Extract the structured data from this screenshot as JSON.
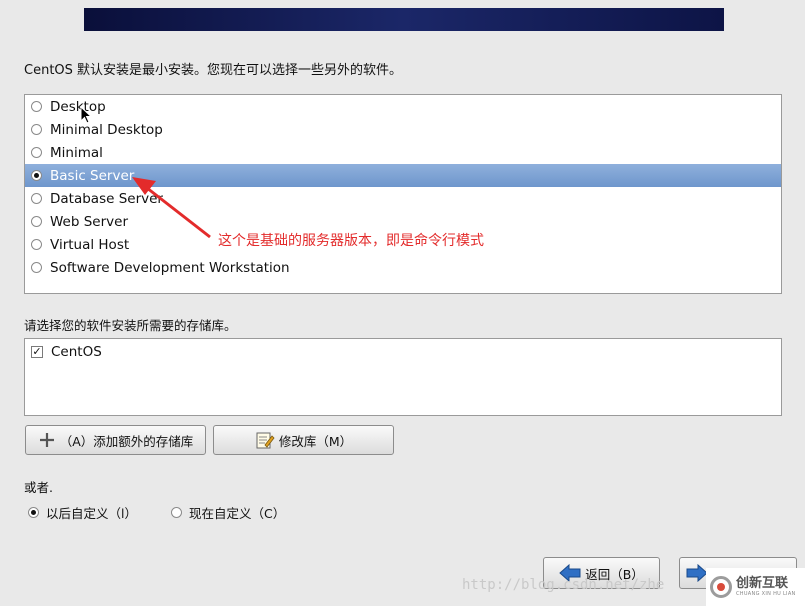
{
  "intro_text": "CentOS 默认安装是最小安装。您现在可以选择一些另外的软件。",
  "environments": [
    {
      "label": "Desktop",
      "selected": false
    },
    {
      "label": "Minimal Desktop",
      "selected": false
    },
    {
      "label": "Minimal",
      "selected": false
    },
    {
      "label": "Basic Server",
      "selected": true
    },
    {
      "label": "Database Server",
      "selected": false
    },
    {
      "label": "Web Server",
      "selected": false
    },
    {
      "label": "Virtual Host",
      "selected": false
    },
    {
      "label": "Software Development Workstation",
      "selected": false
    }
  ],
  "repo_section_label": "请选择您的软件安装所需要的存储库。",
  "repos": [
    {
      "label": "CentOS",
      "checked": true
    }
  ],
  "buttons": {
    "add_repo": "（A）添加额外的存储库",
    "modify_repo": "修改库（M）",
    "back": "返回（B）"
  },
  "customize": {
    "label": "或者.",
    "later": "以后自定义（l）",
    "now": "现在自定义（C）",
    "selected": "later"
  },
  "annotation": "这个是基础的服务器版本，即是命令行模式",
  "watermark": "http://blog.csdn.net/zhe",
  "logo": {
    "cn": "创新互联",
    "en": "CHUANG XIN HU LIAN"
  },
  "colors": {
    "selection": "#7aa0d2",
    "annotation": "#e32b2b"
  },
  "icons": {
    "add": "plus-icon",
    "modify": "edit-notepad-icon",
    "back": "arrow-left-icon",
    "next": "arrow-right-icon"
  }
}
